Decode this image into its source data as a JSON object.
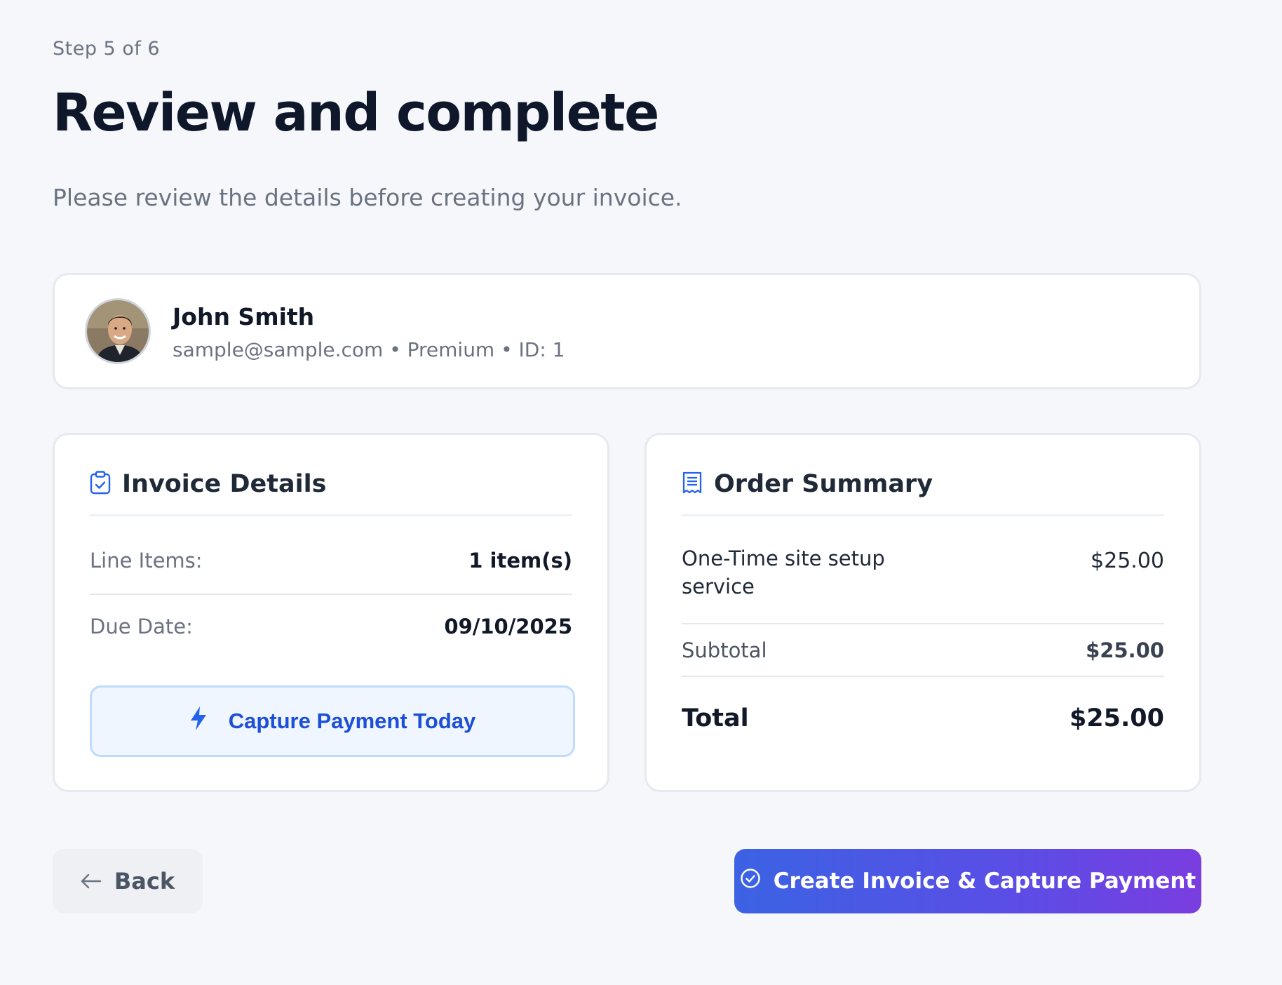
{
  "header": {
    "step": "Step 5 of 6",
    "title": "Review and complete",
    "subtitle": "Please review the details before creating your invoice."
  },
  "customer": {
    "name": "John Smith",
    "meta": "sample@sample.com • Premium • ID: 1"
  },
  "invoice_details": {
    "title": "Invoice Details",
    "line_items_label": "Line Items:",
    "line_items_value": "1 item(s)",
    "due_date_label": "Due Date:",
    "due_date_value": "09/10/2025",
    "capture_button_label": "Capture Payment Today"
  },
  "order_summary": {
    "title": "Order Summary",
    "items": [
      {
        "name": "One-Time site setup service",
        "price": "$25.00"
      }
    ],
    "subtotal_label": "Subtotal",
    "subtotal_value": "$25.00",
    "total_label": "Total",
    "total_value": "$25.00"
  },
  "footer": {
    "back_label": "Back",
    "create_label": "Create Invoice & Capture Payment"
  },
  "icons": {
    "invoice": "clipboard-check-icon",
    "order": "receipt-icon",
    "capture": "lightning-bolt-icon",
    "back": "arrow-left-icon",
    "create": "check-circle-icon"
  },
  "colors": {
    "accent": "#1d4ed8",
    "gradient_start": "#3b63e3",
    "gradient_end": "#7a3de0"
  }
}
